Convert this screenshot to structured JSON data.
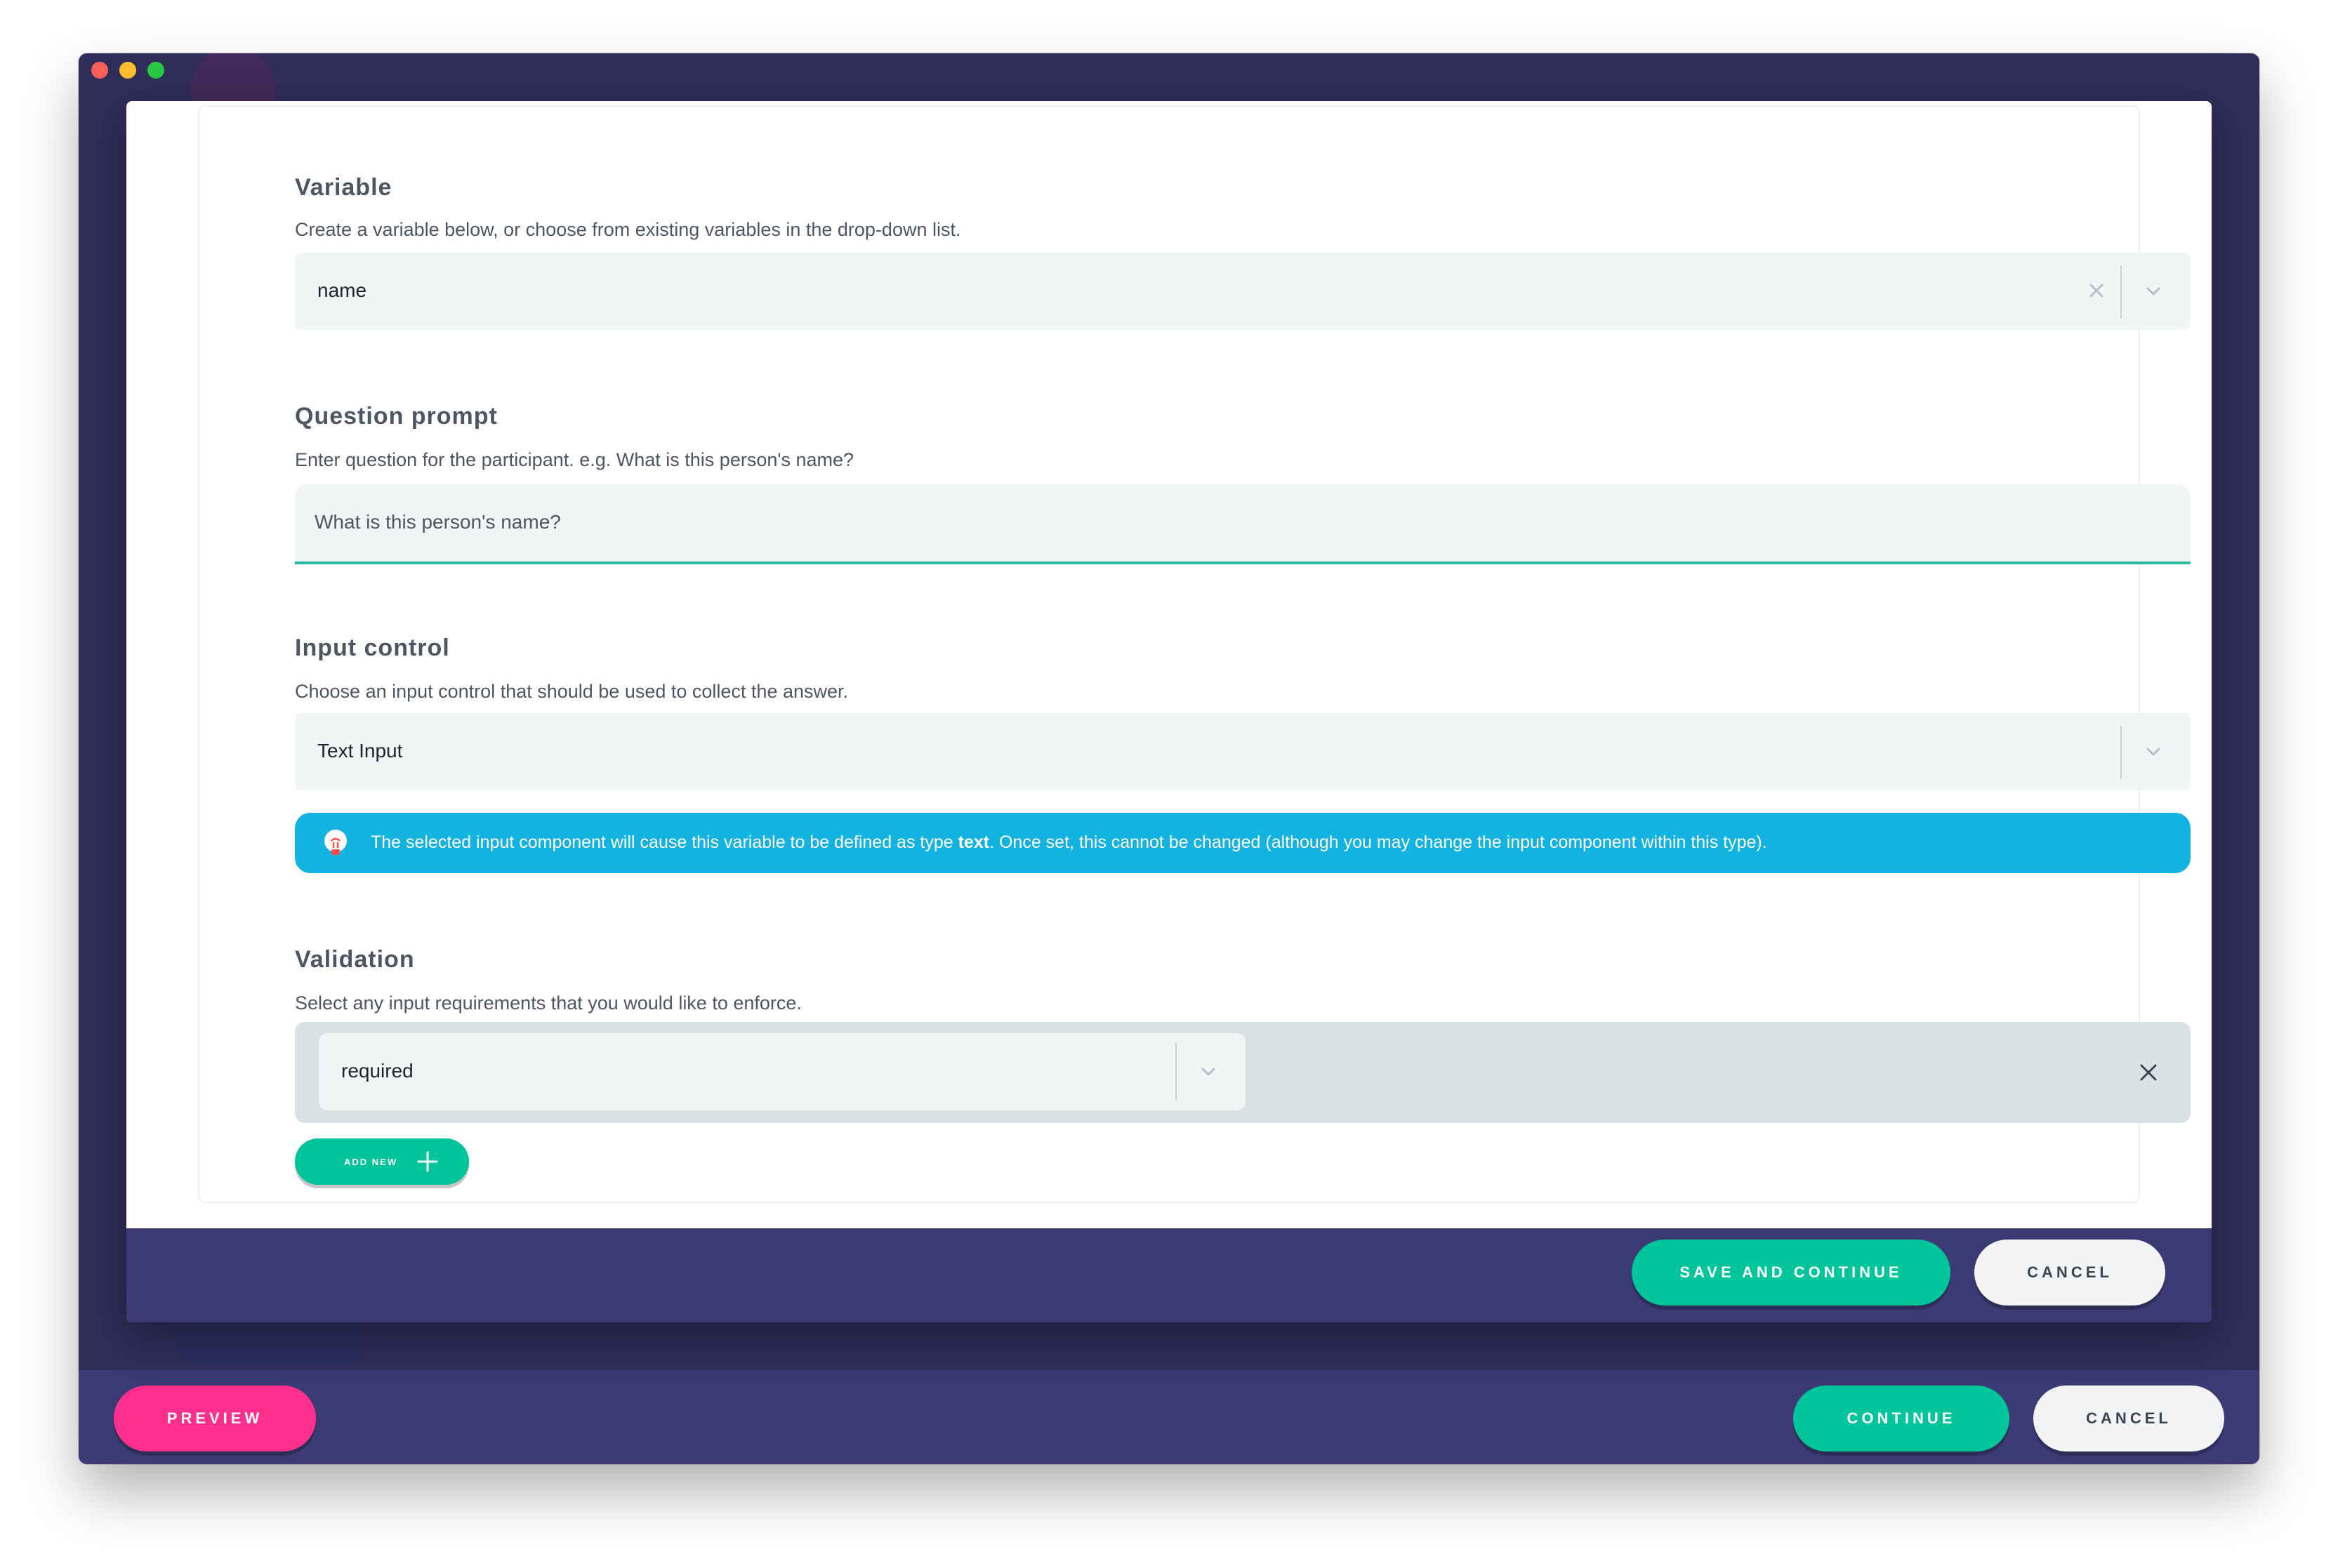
{
  "window": {
    "traffic_lights": [
      "close",
      "minimize",
      "maximize"
    ]
  },
  "footer": {
    "preview_label": "PREVIEW",
    "continue_label": "CONTINUE",
    "cancel_label": "CANCEL"
  },
  "modal": {
    "variable": {
      "title": "Variable",
      "description": "Create a variable below, or choose from existing variables in the drop-down list.",
      "value": "name"
    },
    "question_prompt": {
      "title": "Question prompt",
      "description": "Enter question for the participant. e.g. What is this person's name?",
      "value": "What is this person's name?"
    },
    "input_control": {
      "title": "Input control",
      "description": "Choose an input control that should be used to collect the answer.",
      "value": "Text Input",
      "info_prefix": "The selected input component will cause this variable to be defined as type ",
      "info_type": "text",
      "info_suffix": ". Once set, this cannot be changed (although you may change the input component within this type)."
    },
    "validation": {
      "title": "Validation",
      "description": "Select any input requirements that you would like to enforce.",
      "rules": [
        {
          "value": "required"
        }
      ],
      "add_new_label": "ADD NEW"
    },
    "footer": {
      "save_label": "SAVE AND CONTINUE",
      "cancel_label": "CANCEL"
    }
  },
  "colors": {
    "primary_teal": "#00c49a",
    "preview_pink": "#ff2f8e",
    "info_blue": "#12b2e1",
    "footer_purple": "#3b3a74",
    "background_dark": "#2f2d5a"
  },
  "icons": [
    "clear-icon",
    "chevron-down-icon",
    "lightbulb-icon",
    "close-icon",
    "plus-icon"
  ]
}
